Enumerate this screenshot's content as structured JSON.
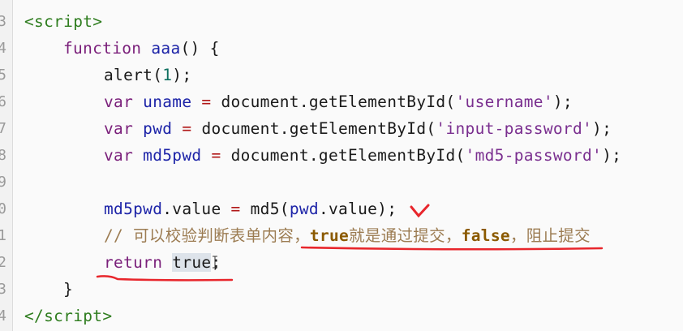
{
  "gutter": {
    "line_numbers": [
      "3",
      "4",
      "5",
      "6",
      "7",
      "8",
      "9",
      "0",
      "1",
      "2",
      "3",
      "4"
    ]
  },
  "code": {
    "l1": {
      "open_tag": "<script>"
    },
    "l2": {
      "kw": "function",
      "name": "aaa",
      "rest": "() {"
    },
    "l3": {
      "fn": "alert(",
      "num": "1",
      "rest": ");"
    },
    "l4": {
      "kw": "var",
      "var": "uname",
      "eq": "=",
      "call": "document.getElementById(",
      "str": "'username'",
      "end": ");"
    },
    "l5": {
      "kw": "var",
      "var": "pwd",
      "eq": "=",
      "call": "document.getElementById(",
      "str": "'input-password'",
      "end": ");"
    },
    "l6": {
      "kw": "var",
      "var": "md5pwd",
      "eq": "=",
      "call": "document.getElementById(",
      "str": "'md5-password'",
      "end": ");"
    },
    "l8": {
      "var": "md5pwd",
      "prop": ".value",
      "eq": "=",
      "call": "md5(",
      "arg": "pwd",
      "rest": ".value);"
    },
    "l9": {
      "c1": "// 可以校验判断表单内容，",
      "c2": "true",
      "c3": "就是通过提交，",
      "c4": "false",
      "c5": "，阻止提交"
    },
    "l10": {
      "kw": "return",
      "val": "true",
      "end": ";"
    },
    "l11": {
      "brace": "}"
    },
    "l12": {
      "close_tag": "</script>"
    }
  },
  "annotation_color": "#e8262c"
}
